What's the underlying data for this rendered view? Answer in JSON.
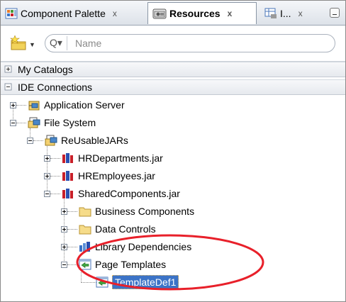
{
  "tabs": [
    {
      "label": "Component Palette",
      "close": "x",
      "icon": "component-palette-icon"
    },
    {
      "label": "Resources",
      "close": "x",
      "icon": "resources-icon"
    },
    {
      "label": "I...",
      "close": "x",
      "icon": "data-controls-icon"
    }
  ],
  "toolbar": {
    "search_placeholder": "Name",
    "search_mode_glyph": "Q▾",
    "new_dropdown_glyph": "▼"
  },
  "sections": {
    "my_catalogs": {
      "label": "My Catalogs",
      "expanded": false
    },
    "ide_connections": {
      "label": "IDE Connections",
      "expanded": true
    }
  },
  "tree": {
    "application_server": "Application Server",
    "file_system": "File System",
    "reusable_jars": "ReUsableJARs",
    "hr_departments": "HRDepartments.jar",
    "hr_employees": "HREmployees.jar",
    "shared_components": "SharedComponents.jar",
    "business_components": "Business Components",
    "data_controls": "Data Controls",
    "library_dependencies": "Library Dependencies",
    "page_templates": "Page Templates",
    "template_def": "TemplateDef1"
  },
  "colors": {
    "selection": "#3b73c7",
    "annotation": "#e8202a",
    "jar_red": "#c8202a",
    "jar_blue": "#2a4fb0"
  }
}
